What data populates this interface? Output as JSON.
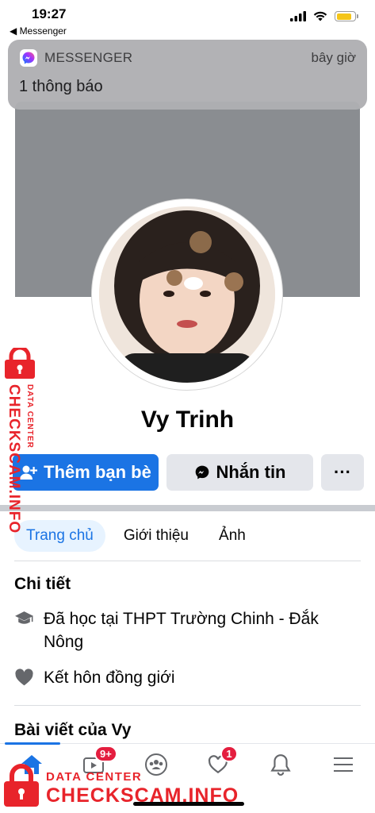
{
  "status_bar": {
    "time": "19:27",
    "back_label": "◀ Messenger",
    "battery_level": 0.85,
    "battery_color": "#f5c518"
  },
  "notification": {
    "app_name": "MESSENGER",
    "time": "bây giờ",
    "body": "1 thông báo",
    "app_icon": "messenger-icon"
  },
  "profile": {
    "name": "Vy Trinh",
    "cover_color": "#8a8d91"
  },
  "actions": {
    "add_friend_label": "Thêm bạn bè",
    "message_label": "Nhắn tin",
    "more_label": "···"
  },
  "tabs": [
    {
      "label": "Trang chủ",
      "active": true
    },
    {
      "label": "Giới thiệu",
      "active": false
    },
    {
      "label": "Ảnh",
      "active": false
    }
  ],
  "details": {
    "title": "Chi tiết",
    "items": [
      {
        "icon": "graduation-cap-icon",
        "text": "Đã học tại THPT Trường Chinh - Đắk Nông"
      },
      {
        "icon": "heart-icon",
        "text": "Kết hôn đồng giới"
      }
    ]
  },
  "posts": {
    "title": "Bài viết của Vy"
  },
  "bottom_nav": {
    "items": [
      {
        "icon": "home-icon",
        "badge": "",
        "active": true
      },
      {
        "icon": "video-icon",
        "badge": "9+"
      },
      {
        "icon": "groups-icon",
        "badge": ""
      },
      {
        "icon": "dating-heart-icon",
        "badge": "1"
      },
      {
        "icon": "bell-icon",
        "badge": ""
      },
      {
        "icon": "menu-icon",
        "badge": ""
      }
    ]
  },
  "watermark": {
    "vertical_big": "CHECKSCAM.INFO",
    "vertical_small": "DATA CENTER",
    "bottom_small": "DATA CENTER",
    "bottom_big": "CHECKSCAM.INFO",
    "color": "#e8242b"
  },
  "colors": {
    "accent": "#1b74e4",
    "badge_red": "#e41e3f"
  }
}
